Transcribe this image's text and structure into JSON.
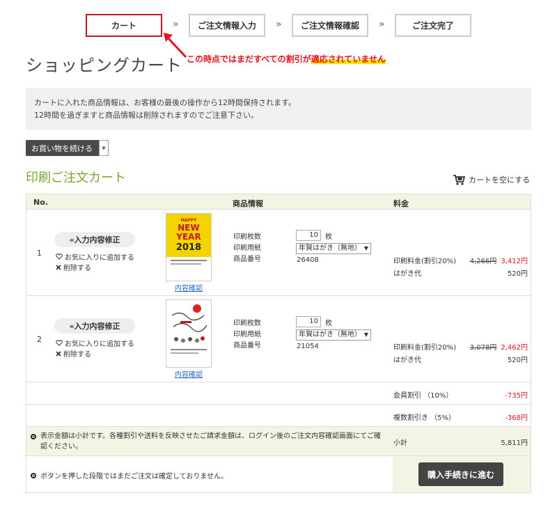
{
  "steps": [
    {
      "label": "カート",
      "active": true
    },
    {
      "label": "ご注文情報入力"
    },
    {
      "label": "ご注文情報確認"
    },
    {
      "label": "ご注文完了"
    }
  ],
  "step_separator": "»",
  "annotation": {
    "text_before": "この時点ではまだすべての割引が",
    "text_highlight": "適応されていません"
  },
  "page_title": "ショッピングカート",
  "notice": {
    "line1": "カートに入れた商品情報は、お客様の最後の操作から12時間保持されます。",
    "line2": "12時間を過ぎますと商品情報は削除されますのでご注意下さい。"
  },
  "continue_button": "お買い物を続ける",
  "section_title": "印刷ご注文カート",
  "empty_cart": "カートを空にする",
  "table_headers": {
    "no": "No.",
    "info": "商品情報",
    "price": "料金"
  },
  "items": [
    {
      "no": "1",
      "edit_label": "入力内容修正",
      "fav_label": "お気に入りに追加する",
      "del_label": "削除する",
      "thumb_link": "内容確認",
      "qty_label": "印刷枚数",
      "paper_label": "印刷用紙",
      "code_label": "商品番号",
      "qty": "10",
      "qty_unit": "枚",
      "paper": "年賀はがき（無地）",
      "code": "26408",
      "print_fee_label": "印刷料金(割引20%)",
      "print_fee_old": "4,266円",
      "print_fee_new": "3,412円",
      "card_fee_label": "はがき代",
      "card_fee": "520円"
    },
    {
      "no": "2",
      "edit_label": "入力内容修正",
      "fav_label": "お気に入りに追加する",
      "del_label": "削除する",
      "thumb_link": "内容確認",
      "qty_label": "印刷枚数",
      "paper_label": "印刷用紙",
      "code_label": "商品番号",
      "qty": "10",
      "qty_unit": "枚",
      "paper": "年賀はがき（無地）",
      "code": "21054",
      "print_fee_label": "印刷料金(割引20%)",
      "print_fee_old": "3,078円",
      "print_fee_new": "2,462円",
      "card_fee_label": "はがき代",
      "card_fee": "520円"
    }
  ],
  "discounts": [
    {
      "label": "会員割引 （10%）",
      "value": "-735円"
    },
    {
      "label": "複数割引き （5%）",
      "value": "-368円"
    }
  ],
  "footer_note": "表示金額は小計です。各種割引や送料を反映させたご請求金額は、ログイン後のご注文内容確認画面にてご確認ください。",
  "subtotal_label": "小計",
  "subtotal_value": "5,811円",
  "bottom_note": "ボタンを押した段階ではまだご注文は確定しておりません。",
  "buy_button": "購入手続きに進む",
  "colors": {
    "accent_red": "#e8101a",
    "green": "#7aa62c",
    "dark_button": "#444444"
  }
}
